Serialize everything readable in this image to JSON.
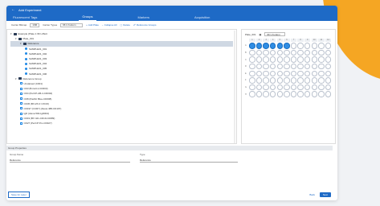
{
  "window": {
    "title": "Add Experiment"
  },
  "tabs": [
    {
      "label": "Fluorescent Tags"
    },
    {
      "label": "Groups"
    },
    {
      "label": "Markers"
    },
    {
      "label": "Acquisition"
    }
  ],
  "toolbar": {
    "selection_mode_label": "Carrier Bitmap",
    "selection_mode_value": "1/96",
    "carrier_type_label": "Carrier Types",
    "carrier_type_value": "96 U bottom",
    "add_plate": "Add Plate",
    "collapse_all": "Collapse All",
    "delete": "Delete",
    "reference_groups": "Reference Groups"
  },
  "tree": [
    {
      "label": "Example (Plate 1 96 U-Bott",
      "level": 0,
      "type": "folder"
    },
    {
      "label": "Plate_001",
      "level": 1,
      "type": "folder"
    },
    {
      "label": "Reference",
      "level": 2,
      "type": "folder",
      "selected": true
    },
    {
      "label": "SAMPLE01_001",
      "level": 3,
      "type": "dot"
    },
    {
      "label": "SAMPLE01_002",
      "level": 3,
      "type": "dot"
    },
    {
      "label": "SAMPLE01_003",
      "level": 3,
      "type": "dot"
    },
    {
      "label": "SAMPLE01_004",
      "level": 3,
      "type": "dot"
    },
    {
      "label": "SAMPLE01_005",
      "level": 3,
      "type": "dot"
    },
    {
      "label": "SAMPLE01_006",
      "level": 3,
      "type": "dot"
    },
    {
      "label": "Reference Group",
      "level": 1,
      "type": "folder"
    },
    {
      "label": "Unstained (C001)",
      "level": 2,
      "type": "doc"
    },
    {
      "label": "CD3 (B-Cell-1-CD003)",
      "level": 2,
      "type": "doc"
    },
    {
      "label": "CD4 (PerCP-AB-4-CD004)",
      "level": 2,
      "type": "doc"
    },
    {
      "label": "CD8 (Pacific Blue-CD008)",
      "level": 2,
      "type": "doc"
    },
    {
      "label": "CD45 (BV-ZX-F CXCR)",
      "level": 2,
      "type": "doc"
    },
    {
      "label": "CD197 (CCR7) (Alexa 488-CD197)",
      "level": 2,
      "type": "doc"
    },
    {
      "label": "IgD (Alexa 500-IgD004)",
      "level": 2,
      "type": "doc"
    },
    {
      "label": "CD19 (BV 421-CD19-C0089)",
      "level": 2,
      "type": "doc"
    },
    {
      "label": "CD27 (PerCP Pro-CD027)",
      "level": 2,
      "type": "doc"
    }
  ],
  "plate": {
    "plate_label": "Plate_001",
    "carrier_value": "96 U bottom",
    "columns": [
      "1",
      "2",
      "3",
      "4",
      "5",
      "6",
      "7",
      "8",
      "9",
      "10",
      "11",
      "12"
    ],
    "rows": [
      "A",
      "B",
      "C",
      "D",
      "E",
      "F",
      "G",
      "H"
    ],
    "filled": [
      [
        "A",
        1
      ],
      [
        "A",
        2
      ],
      [
        "A",
        3
      ],
      [
        "A",
        4
      ],
      [
        "A",
        5
      ],
      [
        "A",
        6
      ]
    ]
  },
  "group_properties": {
    "title": "Group Properties",
    "group_name_label": "Group Name",
    "group_name_value": "Reference",
    "type_label": "Type",
    "type_value": "Reference"
  },
  "footer": {
    "save_later": "Save for Later",
    "back": "Back",
    "next": "Next"
  }
}
